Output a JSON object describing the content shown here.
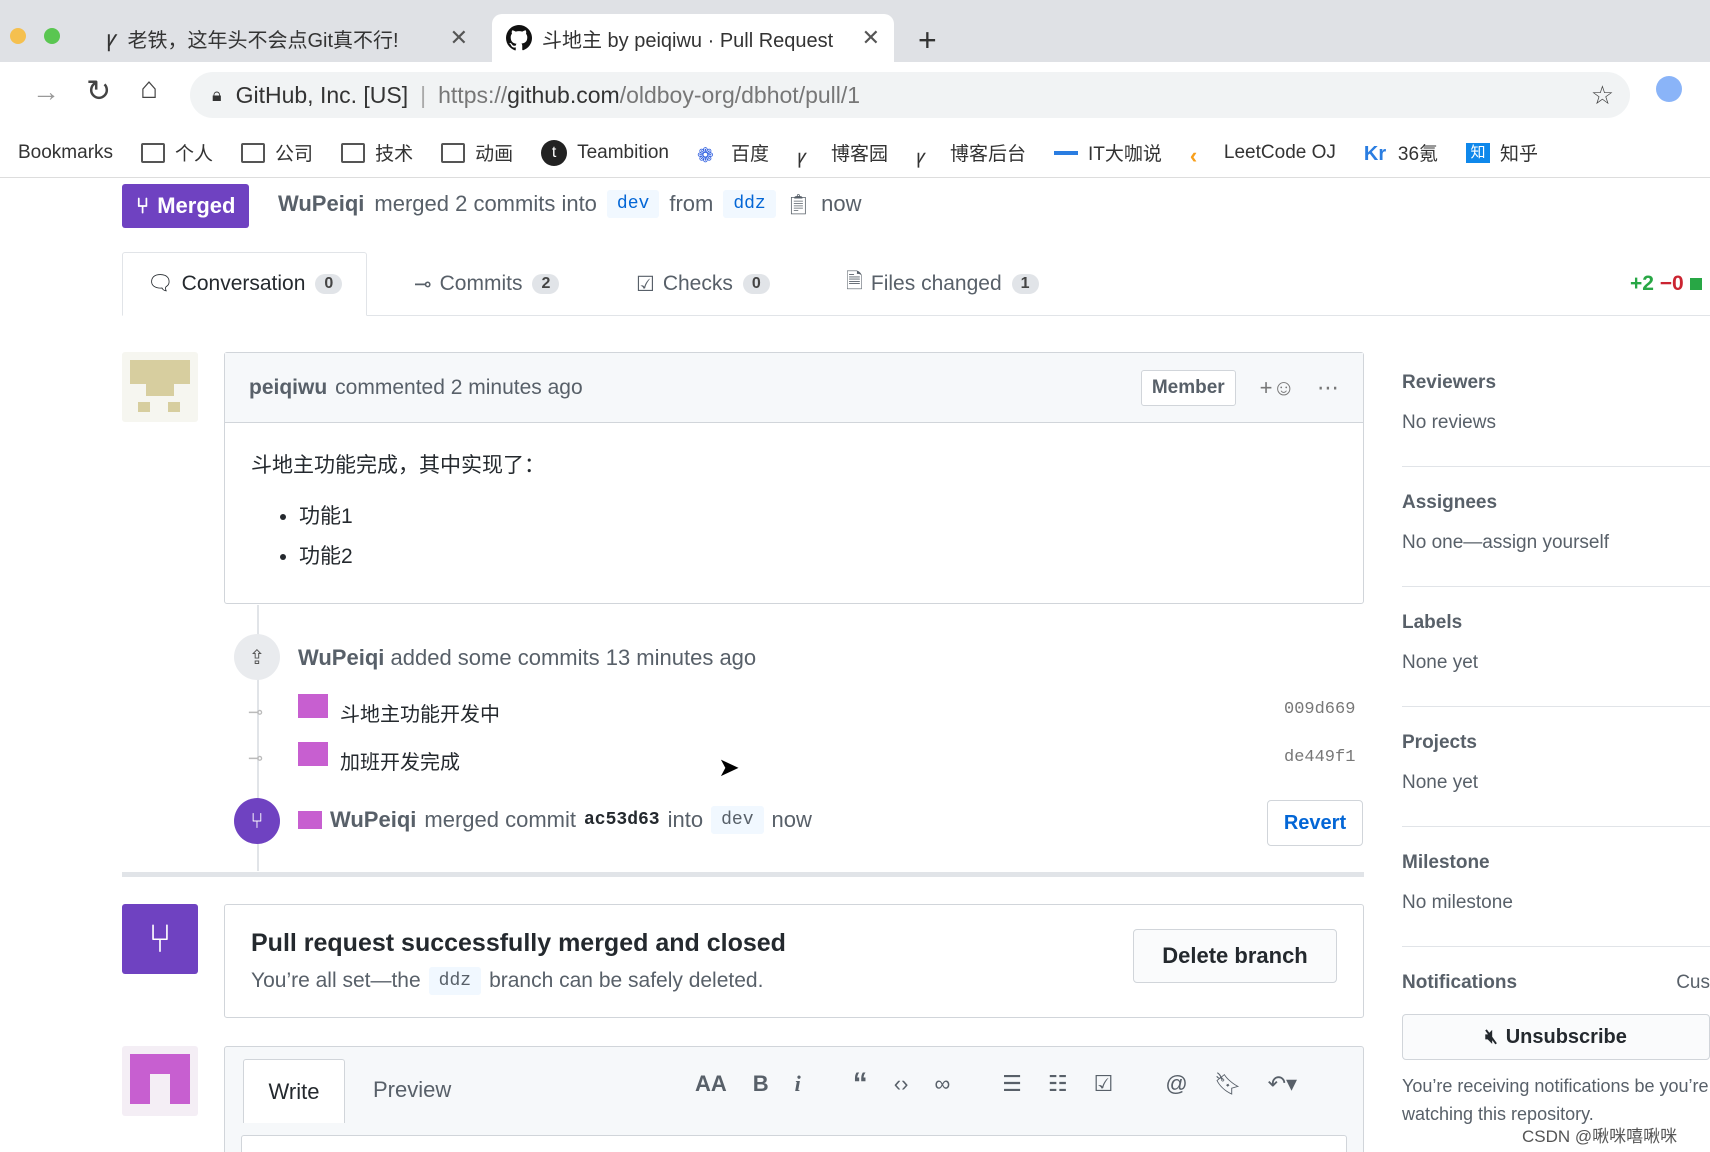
{
  "browser": {
    "tabs": [
      {
        "label": "老铁，这年头不会点Git真不行!"
      },
      {
        "label": "斗地主 by peiqiwu · Pull Request"
      }
    ],
    "url": {
      "site": "GitHub, Inc. [US]",
      "scheme": "https://",
      "domain": "github.com",
      "path": "/oldboy-org/dbhot/pull/1"
    },
    "bookmarks": [
      "Bookmarks",
      "个人",
      "公司",
      "技术",
      "动画",
      "Teambition",
      "百度",
      "博客园",
      "博客后台",
      "IT大咖说",
      "LeetCode OJ",
      "36氪",
      "知乎"
    ]
  },
  "pr": {
    "state": "Merged",
    "author": "WuPeiqi",
    "merged_text": "merged 2 commits into",
    "base": "dev",
    "from_word": "from",
    "head": "ddz",
    "time": "now",
    "diffstat_add": "+2",
    "diffstat_del": "−0"
  },
  "tabs": [
    {
      "label": "Conversation",
      "count": "0"
    },
    {
      "label": "Commits",
      "count": "2"
    },
    {
      "label": "Checks",
      "count": "0"
    },
    {
      "label": "Files changed",
      "count": "1"
    }
  ],
  "comment": {
    "author": "peiqiwu",
    "action": "commented 2 minutes ago",
    "badge": "Member",
    "reaction": "+",
    "body": "斗地主功能完成，其中实现了：",
    "items": [
      "功能1",
      "功能2"
    ]
  },
  "timeline": {
    "added": {
      "author": "WuPeiqi",
      "text": "added some commits 13 minutes ago"
    },
    "commits": [
      {
        "message": "斗地主功能开发中",
        "sha": "009d669"
      },
      {
        "message": "加班开发完成",
        "sha": "de449f1"
      }
    ],
    "merge": {
      "author": "WuPeiqi",
      "text": "merged commit",
      "sha": "ac53d63",
      "into": "into",
      "branch": "dev",
      "time": "now",
      "revert": "Revert"
    }
  },
  "merged_box": {
    "title": "Pull request successfully merged and closed",
    "text_before": "You’re all set—the",
    "branch": "ddz",
    "text_after": "branch can be safely deleted.",
    "delete_button": "Delete branch"
  },
  "editor": {
    "write": "Write",
    "preview": "Preview"
  },
  "sidebar": {
    "sections": [
      {
        "title": "Reviewers",
        "value": "No reviews"
      },
      {
        "title": "Assignees",
        "value": "No one—assign yourself"
      },
      {
        "title": "Labels",
        "value": "None yet"
      },
      {
        "title": "Projects",
        "value": "None yet"
      },
      {
        "title": "Milestone",
        "value": "No milestone"
      }
    ],
    "notifications": {
      "title": "Notifications",
      "customize": "Cus",
      "button": "Unsubscribe",
      "text": "You’re receiving notifications be you’re watching this repository."
    }
  },
  "watermark": "CSDN @啾咪嘻啾咪",
  "colors": {
    "merged": "#6f42c1",
    "link": "#0366d6",
    "add": "#28a745",
    "del": "#cb2431"
  }
}
